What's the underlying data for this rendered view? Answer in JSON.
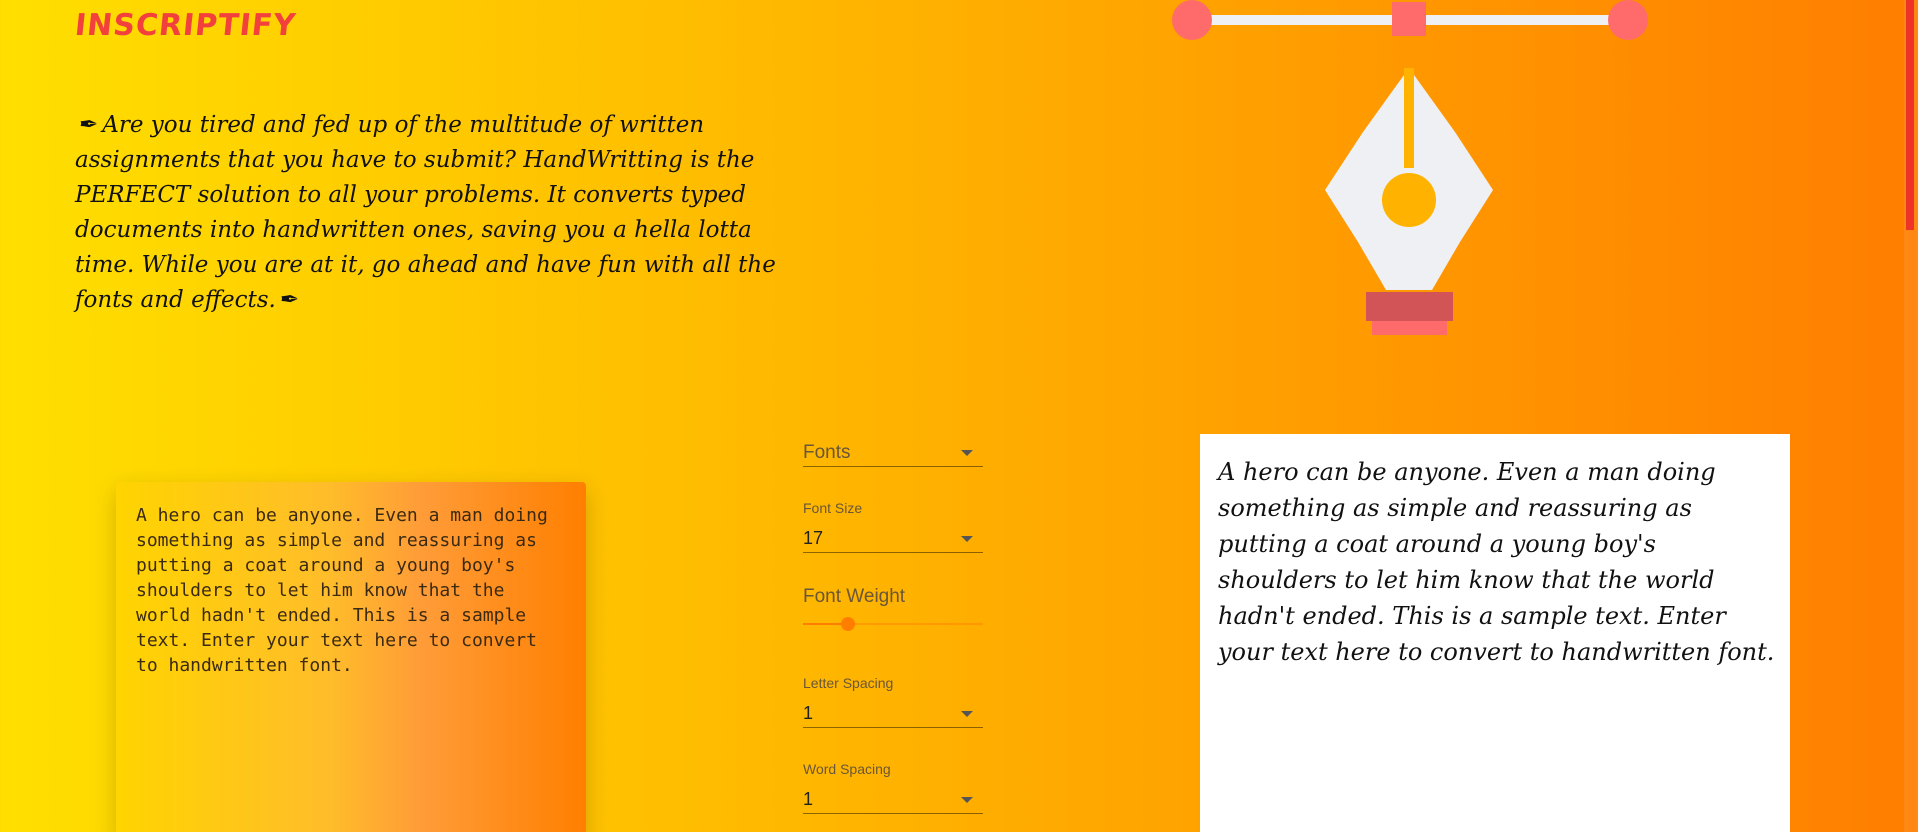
{
  "app": {
    "logo_text": "INSCRIPTIFY",
    "intro_text": "Are you tired and fed up of the multitude of written assignments that you have to submit? HandWritting is the PERFECT solution to all your problems. It converts typed documents into handwritten ones, saving you a hella lotta time. While you are at it, go ahead and have fun with all the fonts and effects.",
    "intro_icons": [
      "pen-icon",
      "pen-icon"
    ]
  },
  "colors": {
    "background_start": "#ffdf00",
    "background_end": "#ff7e00",
    "logo": "#f2403c",
    "accent": "#ff7e00",
    "card_output": "#ffffff",
    "pen_body": "#eef0f3",
    "pen_accent": "#ff6b6b"
  },
  "input": {
    "value": "A hero can be anyone. Even a man doing something as simple and reassuring as putting a coat around a young boy's shoulders to let him know that the world hadn't ended. This is a sample text. Enter your text here to convert to handwritten font."
  },
  "controls": {
    "fonts": {
      "placeholder": "Fonts"
    },
    "font_size": {
      "label": "Font Size",
      "value": "17"
    },
    "font_weight": {
      "label": "Font Weight",
      "value_fraction": 0.25
    },
    "letter_spacing": {
      "label": "Letter Spacing",
      "value": "1"
    },
    "word_spacing": {
      "label": "Word Spacing",
      "value": "1"
    }
  },
  "output": {
    "text": "A hero can be anyone. Even a man doing something as simple and reassuring as putting a coat around a young boy's shoulders to let him know that the world hadn't ended. This is a sample text. Enter your text here to convert to handwritten font."
  }
}
